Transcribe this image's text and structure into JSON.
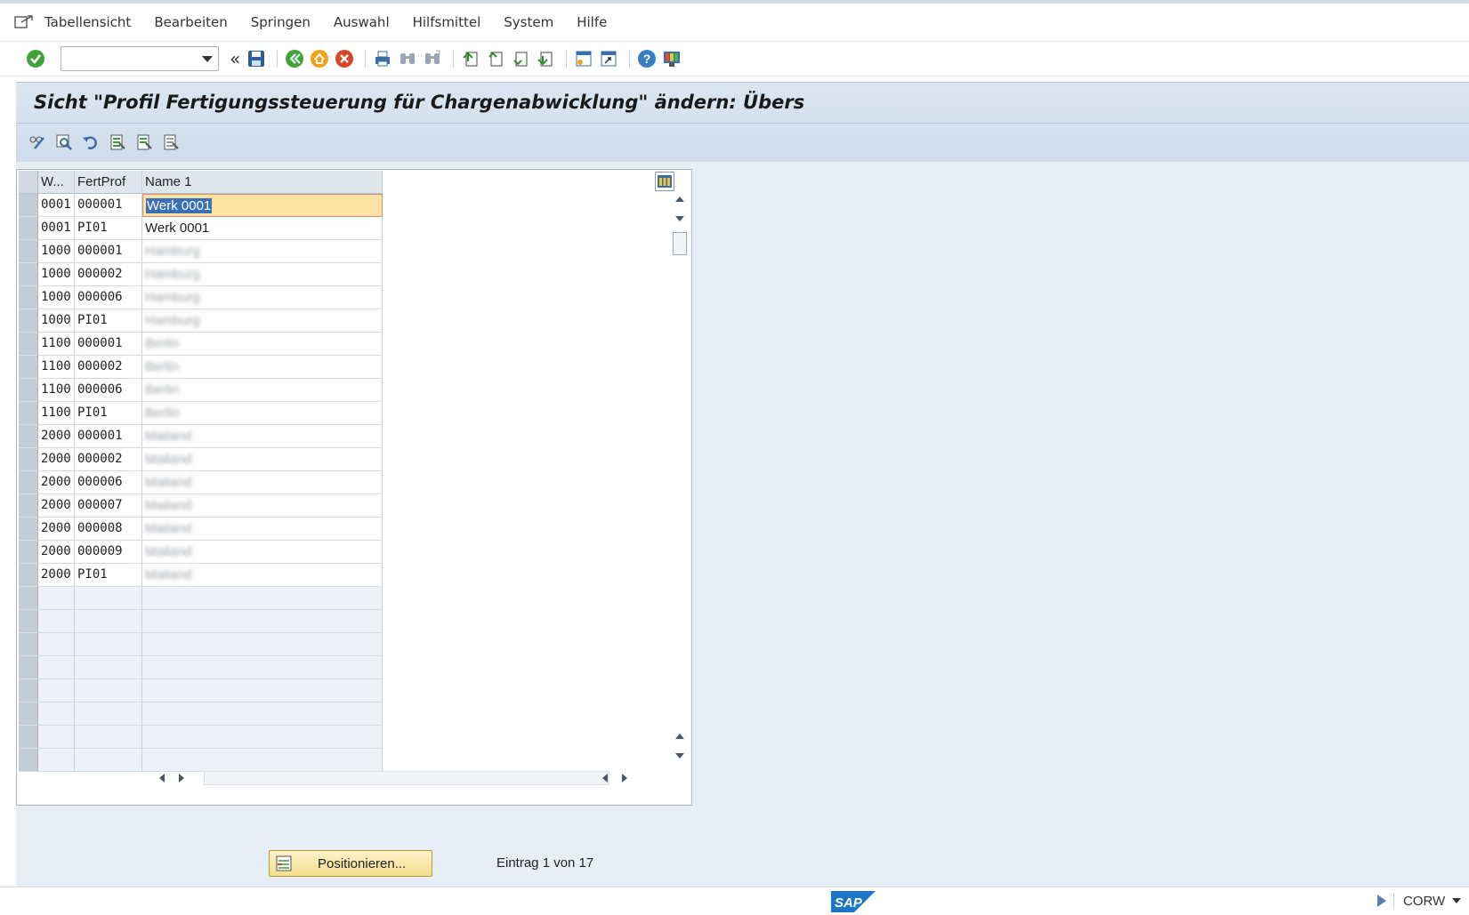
{
  "menu": {
    "items": [
      {
        "label": "Tabellensicht"
      },
      {
        "label": "Bearbeiten"
      },
      {
        "label": "Springen"
      },
      {
        "label": "Auswahl"
      },
      {
        "label": "Hilfsmittel"
      },
      {
        "label": "System"
      },
      {
        "label": "Hilfe"
      }
    ]
  },
  "toolbar": {
    "command_value": "",
    "icons": [
      "enter-icon",
      "save-icon",
      "back-icon",
      "exit-icon",
      "cancel-icon",
      "print-icon",
      "find-icon",
      "find-next-icon",
      "first-page-icon",
      "prev-page-icon",
      "next-page-icon",
      "last-page-icon",
      "create-session-icon",
      "shortcut-icon",
      "help-icon",
      "customize-layout-icon"
    ]
  },
  "title": "Sicht \"Profil Fertigungssteuerung für Chargenabwicklung\" ändern: Übers",
  "table": {
    "columns": [
      "W...",
      "FertProf",
      "Name 1"
    ],
    "rows": [
      {
        "w": "0001",
        "fp": "000001",
        "name": "Werk 0001"
      },
      {
        "w": "0001",
        "fp": "PI01",
        "name": "Werk 0001"
      },
      {
        "w": "1000",
        "fp": "000001",
        "name": "Hamburg"
      },
      {
        "w": "1000",
        "fp": "000002",
        "name": "Hamburg"
      },
      {
        "w": "1000",
        "fp": "000006",
        "name": "Hamburg"
      },
      {
        "w": "1000",
        "fp": "PI01",
        "name": "Hamburg"
      },
      {
        "w": "1100",
        "fp": "000001",
        "name": "Berlin"
      },
      {
        "w": "1100",
        "fp": "000002",
        "name": "Berlin"
      },
      {
        "w": "1100",
        "fp": "000006",
        "name": "Berlin"
      },
      {
        "w": "1100",
        "fp": "PI01",
        "name": "Berlin"
      },
      {
        "w": "2000",
        "fp": "000001",
        "name": "Mailand"
      },
      {
        "w": "2000",
        "fp": "000002",
        "name": "Mailand"
      },
      {
        "w": "2000",
        "fp": "000006",
        "name": "Mailand"
      },
      {
        "w": "2000",
        "fp": "000007",
        "name": "Mailand"
      },
      {
        "w": "2000",
        "fp": "000008",
        "name": "Mailand"
      },
      {
        "w": "2000",
        "fp": "000009",
        "name": "Mailand"
      },
      {
        "w": "2000",
        "fp": "PI01",
        "name": "Mailand"
      }
    ]
  },
  "buttons": {
    "position_label": "Positionieren..."
  },
  "entry_info": "Eintrag 1 von 17",
  "status": {
    "system": "CORW",
    "logo": "SAP"
  },
  "colors": {
    "title_bg": "#dbe6f1",
    "content_bg": "#e7eef5",
    "selected_cell_bg": "#fbe4a3",
    "sap_blue": "#1e75c8"
  }
}
